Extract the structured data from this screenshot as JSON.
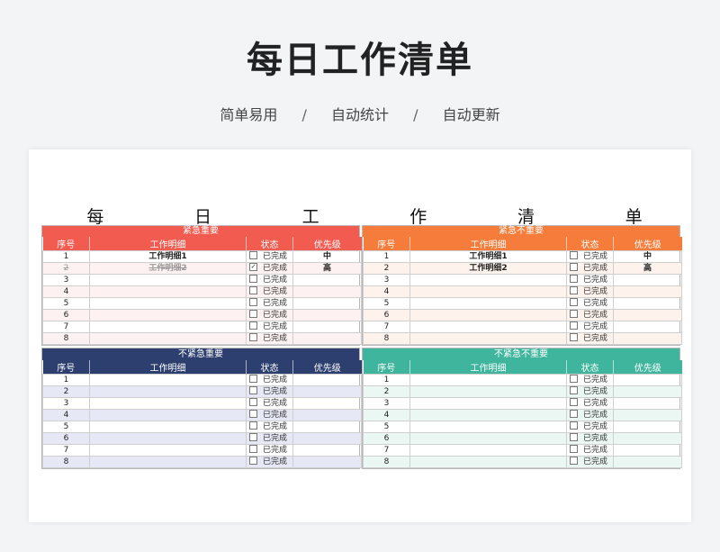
{
  "header": {
    "title": "每日工作清单",
    "subtitle_parts": [
      "简单易用",
      "自动统计",
      "自动更新"
    ],
    "separator": "/"
  },
  "sheet": {
    "title_chars": [
      "每",
      "日",
      "工",
      "作",
      "清",
      "单"
    ],
    "columns": [
      "序号",
      "工作明细",
      "状态",
      "优先级"
    ],
    "status_label": "已完成",
    "quadrants": [
      {
        "title": "紧急重要",
        "color": "#f25b50",
        "rows": [
          {
            "no": "1",
            "detail": "工作明细1",
            "done": false,
            "priority": "中"
          },
          {
            "no": "2",
            "detail": "工作明细2",
            "done": true,
            "priority": "高"
          },
          {
            "no": "3",
            "detail": "",
            "done": false,
            "priority": ""
          },
          {
            "no": "4",
            "detail": "",
            "done": false,
            "priority": ""
          },
          {
            "no": "5",
            "detail": "",
            "done": false,
            "priority": ""
          },
          {
            "no": "6",
            "detail": "",
            "done": false,
            "priority": ""
          },
          {
            "no": "7",
            "detail": "",
            "done": false,
            "priority": ""
          },
          {
            "no": "8",
            "detail": "",
            "done": false,
            "priority": ""
          }
        ]
      },
      {
        "title": "紧急不重要",
        "color": "#f57c3a",
        "rows": [
          {
            "no": "1",
            "detail": "工作明细1",
            "done": false,
            "priority": "中"
          },
          {
            "no": "2",
            "detail": "工作明细2",
            "done": false,
            "priority": "高"
          },
          {
            "no": "3",
            "detail": "",
            "done": false,
            "priority": ""
          },
          {
            "no": "4",
            "detail": "",
            "done": false,
            "priority": ""
          },
          {
            "no": "5",
            "detail": "",
            "done": false,
            "priority": ""
          },
          {
            "no": "6",
            "detail": "",
            "done": false,
            "priority": ""
          },
          {
            "no": "7",
            "detail": "",
            "done": false,
            "priority": ""
          },
          {
            "no": "8",
            "detail": "",
            "done": false,
            "priority": ""
          }
        ]
      },
      {
        "title": "不紧急重要",
        "color": "#2d3f6e",
        "rows": [
          {
            "no": "1",
            "detail": "",
            "done": false,
            "priority": ""
          },
          {
            "no": "2",
            "detail": "",
            "done": false,
            "priority": ""
          },
          {
            "no": "3",
            "detail": "",
            "done": false,
            "priority": ""
          },
          {
            "no": "4",
            "detail": "",
            "done": false,
            "priority": ""
          },
          {
            "no": "5",
            "detail": "",
            "done": false,
            "priority": ""
          },
          {
            "no": "6",
            "detail": "",
            "done": false,
            "priority": ""
          },
          {
            "no": "7",
            "detail": "",
            "done": false,
            "priority": ""
          },
          {
            "no": "8",
            "detail": "",
            "done": false,
            "priority": ""
          }
        ]
      },
      {
        "title": "不紧急不重要",
        "color": "#3eb59c",
        "rows": [
          {
            "no": "1",
            "detail": "",
            "done": false,
            "priority": ""
          },
          {
            "no": "2",
            "detail": "",
            "done": false,
            "priority": ""
          },
          {
            "no": "3",
            "detail": "",
            "done": false,
            "priority": ""
          },
          {
            "no": "4",
            "detail": "",
            "done": false,
            "priority": ""
          },
          {
            "no": "5",
            "detail": "",
            "done": false,
            "priority": ""
          },
          {
            "no": "6",
            "detail": "",
            "done": false,
            "priority": ""
          },
          {
            "no": "7",
            "detail": "",
            "done": false,
            "priority": ""
          },
          {
            "no": "8",
            "detail": "",
            "done": false,
            "priority": ""
          }
        ]
      }
    ]
  }
}
